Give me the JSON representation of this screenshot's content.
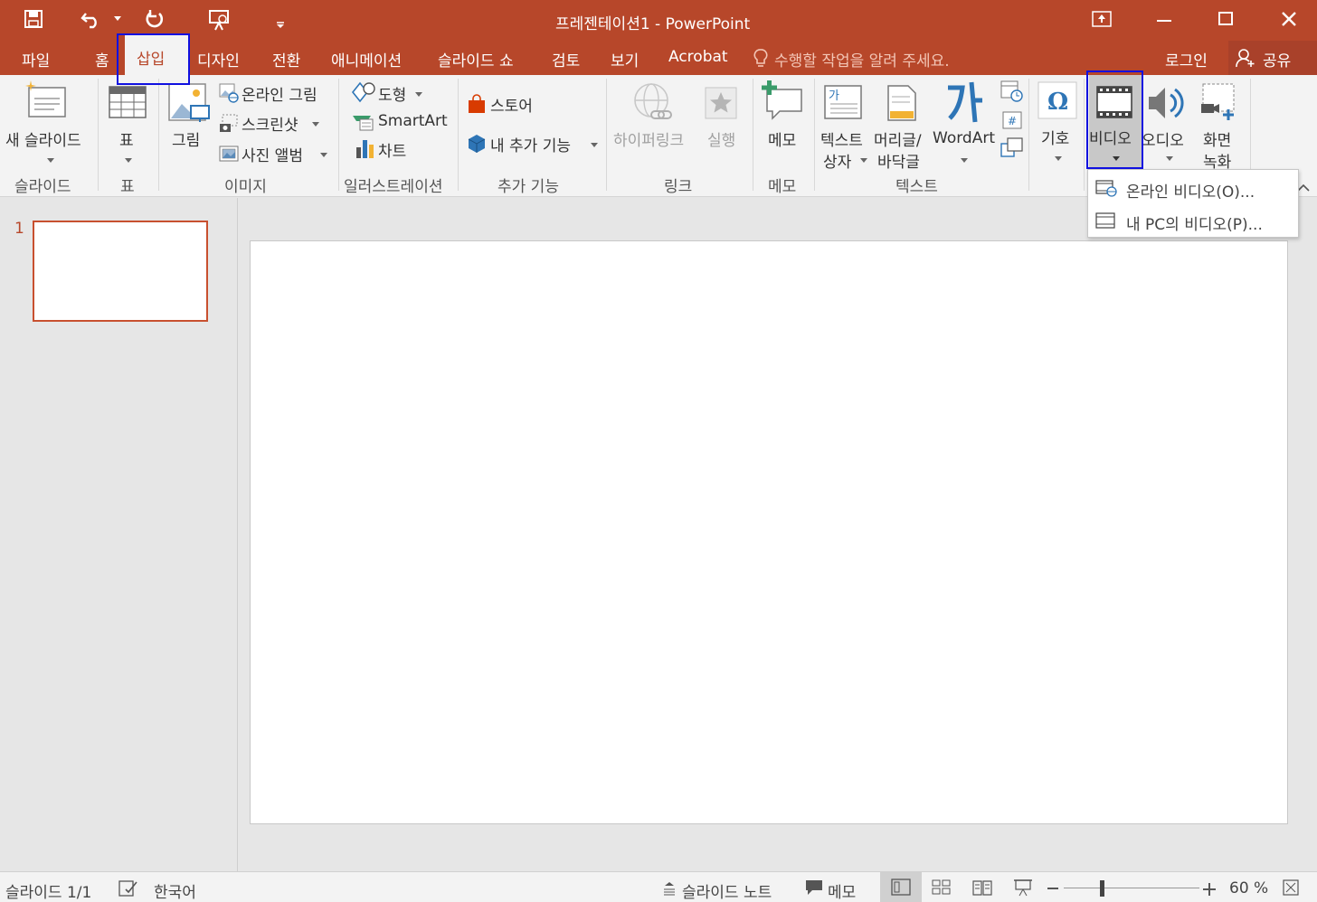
{
  "titlebar": {
    "title": "프레젠테이션1 - PowerPoint"
  },
  "tabs": {
    "file": "파일",
    "home": "홈",
    "insert": "삽입",
    "design": "디자인",
    "transitions": "전환",
    "animations": "애니메이션",
    "slideshow": "슬라이드 쇼",
    "review": "검토",
    "view": "보기",
    "acrobat": "Acrobat",
    "tellme": "수행할 작업을 알려 주세요.",
    "signin": "로그인",
    "share": "공유"
  },
  "ribbon": {
    "new_slide": "새 슬라이드",
    "group_slides": "슬라이드",
    "table": "표",
    "group_table": "표",
    "picture": "그림",
    "online_picture": "온라인 그림",
    "screenshot": "스크린샷",
    "photo_album": "사진 앨범",
    "group_images": "이미지",
    "shapes": "도형",
    "smartart": "SmartArt",
    "chart": "차트",
    "group_illustrations": "일러스트레이션",
    "store": "스토어",
    "my_addins": "내 추가 기능",
    "group_addins": "추가 기능",
    "hyperlink": "하이퍼링크",
    "action": "실행",
    "group_links": "링크",
    "comment": "메모",
    "group_comments": "메모",
    "textbox_1": "텍스트",
    "textbox_2": "상자",
    "header_1": "머리글/",
    "header_2": "바닥글",
    "wordart": "WordArt",
    "group_text": "텍스트",
    "symbols": "기호",
    "video": "비디오",
    "audio": "오디오",
    "screen_rec_1": "화면",
    "screen_rec_2": "녹화"
  },
  "video_menu": {
    "online_video": "온라인 비디오(O)...",
    "pc_video": "내 PC의 비디오(P)..."
  },
  "slides": {
    "number": "1"
  },
  "statusbar": {
    "slide_info": "슬라이드 1/1",
    "language": "한국어",
    "notes": "슬라이드 노트",
    "comments": "메모",
    "zoom": "60 %"
  },
  "colors": {
    "accent": "#b7472a",
    "highlight": "#1010e0"
  }
}
